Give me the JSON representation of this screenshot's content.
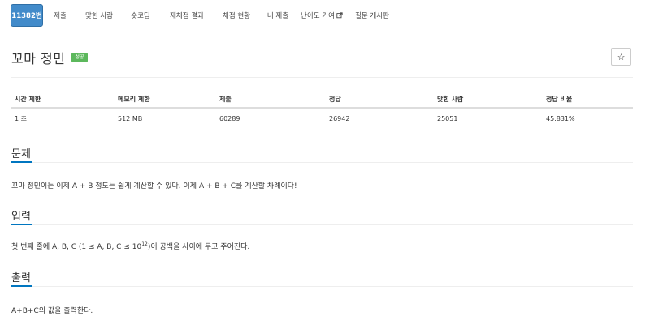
{
  "tabs": [
    {
      "label": "11382번",
      "active": true
    },
    {
      "label": "제출",
      "active": false
    },
    {
      "label": "맞힌 사람",
      "active": false
    },
    {
      "label": "숏코딩",
      "active": false
    },
    {
      "label": "재채점 결과",
      "active": false
    },
    {
      "label": "채점 현황",
      "active": false
    },
    {
      "label": "내 제출",
      "active": false
    },
    {
      "label": "난이도 기여",
      "active": false,
      "icon": "external-link-icon"
    },
    {
      "label": "질문 게시판",
      "active": false
    }
  ],
  "problem": {
    "title": "꼬마 정민",
    "badge": "성공",
    "star_icon": "☆"
  },
  "info_table": {
    "headers": [
      "시간 제한",
      "메모리 제한",
      "제출",
      "정답",
      "맞힌 사람",
      "정답 비율"
    ],
    "row": [
      "1 초",
      "512 MB",
      "60289",
      "26942",
      "25051",
      "45.831%"
    ]
  },
  "sections": {
    "problem": {
      "heading": "문제",
      "text": "꼬마 정민이는 이제 A + B 정도는 쉽게 계산할 수 있다. 이제 A + B + C를 계산할 차례이다!"
    },
    "input": {
      "heading": "입력",
      "text_before": "첫 번째 줄에 A, B, C (1 ≤ A, B, C ≤ 10",
      "superscript": "12",
      "text_after": ")이 공백을 사이에 두고 주어진다."
    },
    "output": {
      "heading": "출력",
      "text": "A+B+C의 값을 출력한다."
    }
  },
  "colors": {
    "active_tab": "#428bca",
    "badge_success": "#5cb85c",
    "section_accent": "#0076c0"
  }
}
